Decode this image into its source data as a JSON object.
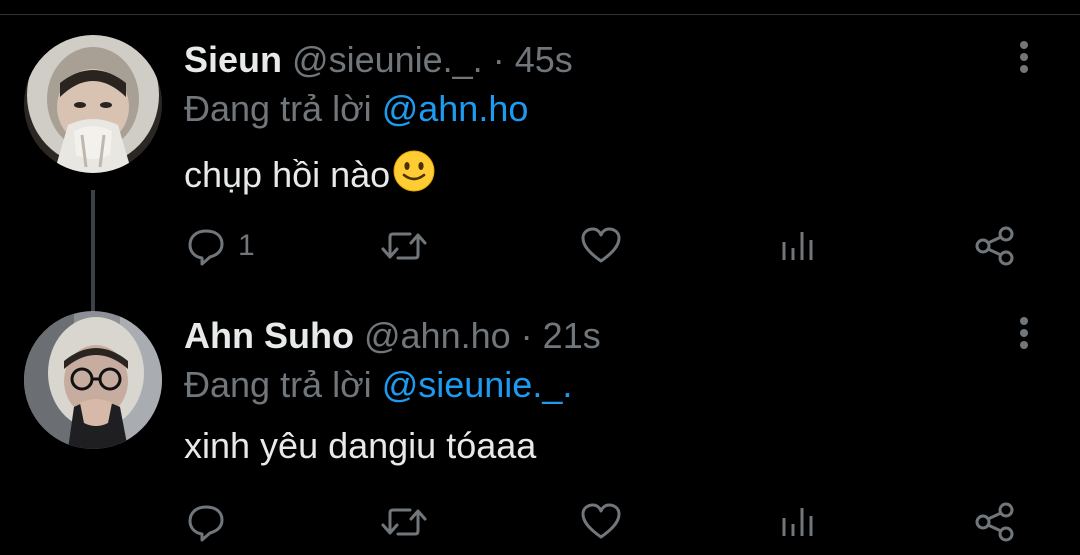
{
  "colors": {
    "background": "#000000",
    "text": "#e7e9ea",
    "secondary": "#71767b",
    "accent": "#1d9bf0",
    "thread_line": "#3e4144"
  },
  "tweets": [
    {
      "name": "Sieun",
      "handle": "@sieunie._.",
      "separator": "·",
      "time": "45s",
      "replying_prefix": "Đang trả lời",
      "replying_to": "@ahn.ho",
      "text": "chụp hồi nào",
      "emoji": "slightly-smiling-face",
      "reply_count": "1",
      "icons": [
        "reply-icon",
        "retweet-icon",
        "like-icon",
        "views-icon",
        "share-icon",
        "more-icon"
      ]
    },
    {
      "name": "Ahn Suho",
      "handle": "@ahn.ho",
      "separator": "·",
      "time": "21s",
      "replying_prefix": "Đang trả lời",
      "replying_to": "@sieunie._.",
      "text": "xinh yêu dangiu tóaaa",
      "reply_count": "",
      "icons": [
        "reply-icon",
        "retweet-icon",
        "like-icon",
        "views-icon",
        "share-icon",
        "more-icon"
      ]
    }
  ]
}
